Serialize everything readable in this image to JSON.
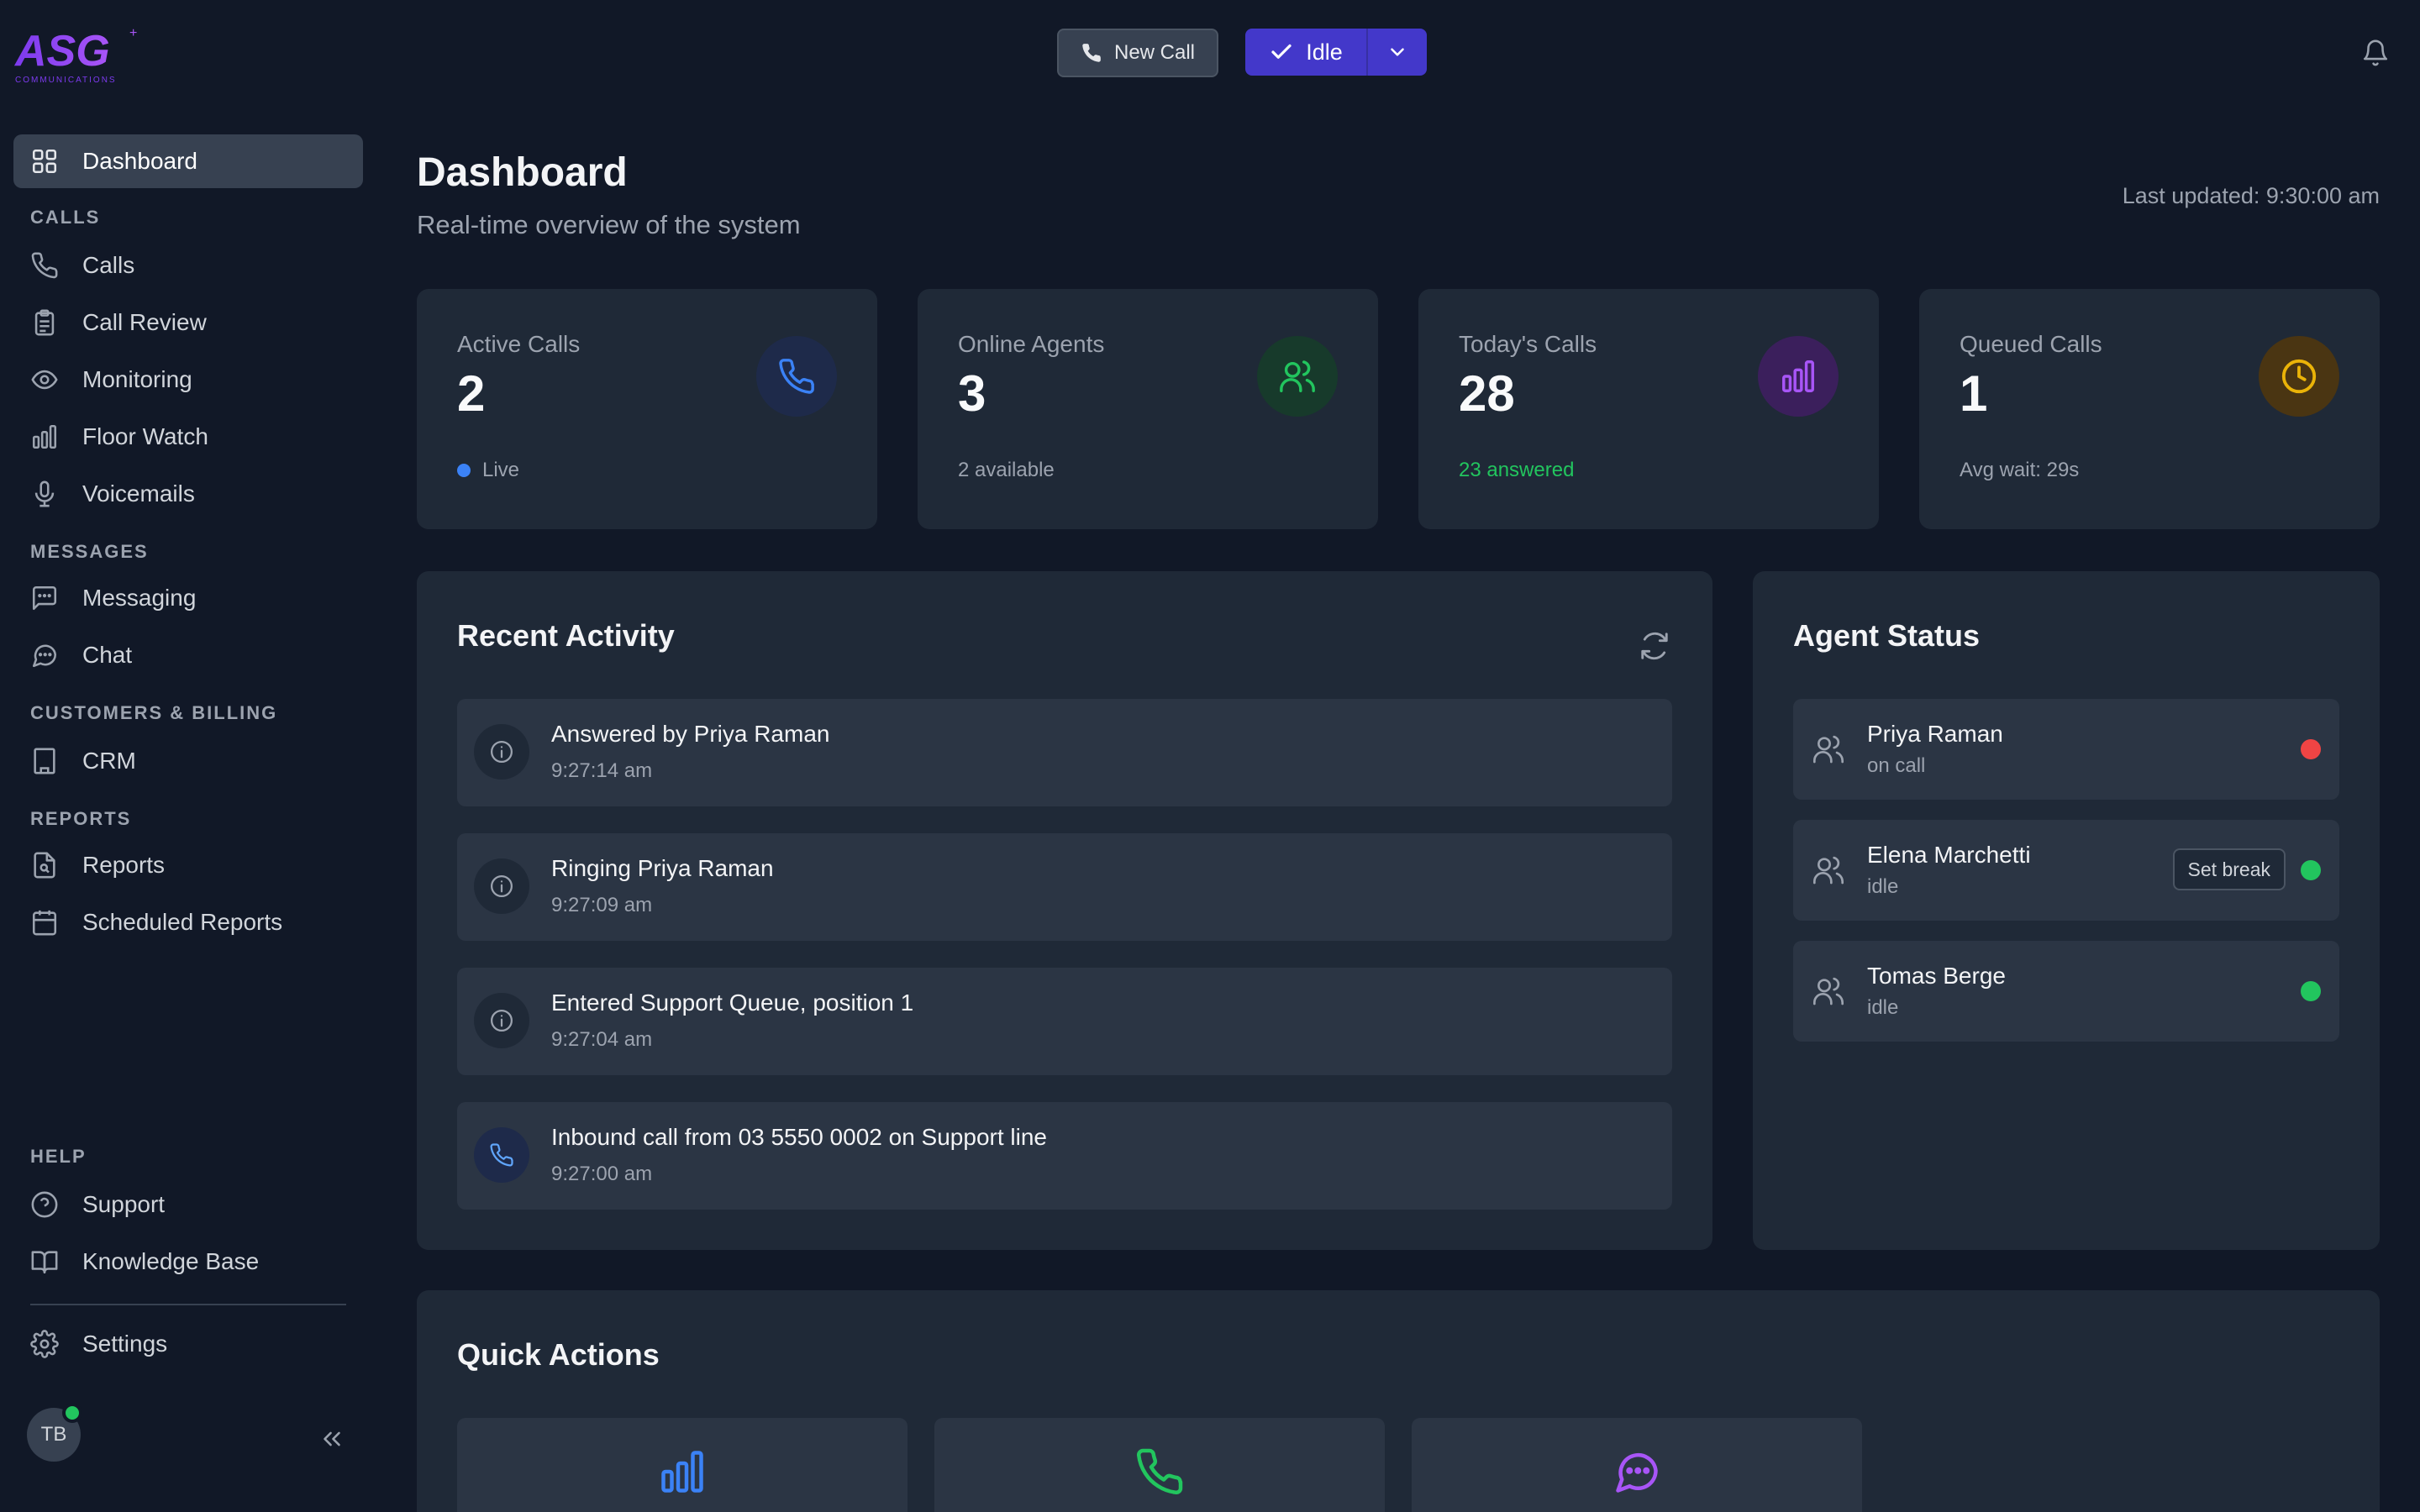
{
  "brand": {
    "logo_text": "ASG",
    "logo_sub": "COMMUNICATIONS"
  },
  "sidebar": {
    "active_item": {
      "label": "Dashboard",
      "icon": "grid-icon"
    },
    "sections": [
      {
        "label": "CALLS",
        "items": [
          {
            "label": "Calls",
            "icon": "phone-icon"
          },
          {
            "label": "Call Review",
            "icon": "clipboard-icon"
          },
          {
            "label": "Monitoring",
            "icon": "eye-icon"
          },
          {
            "label": "Floor Watch",
            "icon": "bar-chart-icon"
          },
          {
            "label": "Voicemails",
            "icon": "microphone-icon"
          }
        ]
      },
      {
        "label": "MESSAGES",
        "items": [
          {
            "label": "Messaging",
            "icon": "message-square-icon"
          },
          {
            "label": "Chat",
            "icon": "chat-bubble-icon"
          }
        ]
      },
      {
        "label": "CUSTOMERS & BILLING",
        "items": [
          {
            "label": "CRM",
            "icon": "building-icon"
          }
        ]
      },
      {
        "label": "REPORTS",
        "items": [
          {
            "label": "Reports",
            "icon": "file-search-icon"
          },
          {
            "label": "Scheduled Reports",
            "icon": "calendar-icon"
          }
        ]
      },
      {
        "label": "HELP",
        "items": [
          {
            "label": "Support",
            "icon": "help-circle-icon"
          },
          {
            "label": "Knowledge Base",
            "icon": "book-icon"
          }
        ]
      }
    ],
    "settings": {
      "label": "Settings",
      "icon": "gear-icon"
    },
    "user_initials": "TB",
    "user_online": true
  },
  "topbar": {
    "new_call_label": "New Call",
    "status_label": "Idle"
  },
  "header": {
    "title": "Dashboard",
    "subtitle": "Real-time overview of the system",
    "last_updated": "Last updated: 9:30:00 am"
  },
  "stats": [
    {
      "label": "Active Calls",
      "value": "2",
      "foot": "Live",
      "icon": "phone-icon",
      "color": "#3b82f6",
      "bg": "#1e2a4a"
    },
    {
      "label": "Online Agents",
      "value": "3",
      "foot": "2 available",
      "icon": "users-icon",
      "color": "#22c55e",
      "bg": "#173a2b"
    },
    {
      "label": "Today's Calls",
      "value": "28",
      "foot": "23 answered",
      "icon": "bar-chart-icon",
      "color": "#a855f7",
      "bg": "#3b1f5c"
    },
    {
      "label": "Queued Calls",
      "value": "1",
      "foot": "Avg wait: 29s",
      "icon": "clock-icon",
      "color": "#eab308",
      "bg": "#4a3512"
    }
  ],
  "recent_activity": {
    "title": "Recent Activity",
    "items": [
      {
        "text": "Answered by Priya Raman",
        "time": "9:27:14 am",
        "icon": "info-icon"
      },
      {
        "text": "Ringing Priya Raman",
        "time": "9:27:09 am",
        "icon": "info-icon"
      },
      {
        "text": "Entered Support Queue, position 1",
        "time": "9:27:04 am",
        "icon": "info-icon"
      },
      {
        "text": "Inbound call from 03 5550 0002 on Support line",
        "time": "9:27:00 am",
        "icon": "phone-icon"
      }
    ]
  },
  "agent_status": {
    "title": "Agent Status",
    "agents": [
      {
        "name": "Priya Raman",
        "status": "on call",
        "dot_color": "#ef4444"
      },
      {
        "name": "Elena Marchetti",
        "status": "idle",
        "dot_color": "#22c55e",
        "action": "Set break"
      },
      {
        "name": "Tomas Berge",
        "status": "idle",
        "dot_color": "#22c55e"
      }
    ]
  },
  "quick_actions": {
    "title": "Quick Actions",
    "cards": [
      {
        "icon": "bar-chart-icon",
        "color": "#3b82f6"
      },
      {
        "icon": "phone-icon",
        "color": "#22c55e"
      },
      {
        "icon": "chat-bubble-icon",
        "color": "#a855f7"
      }
    ]
  }
}
